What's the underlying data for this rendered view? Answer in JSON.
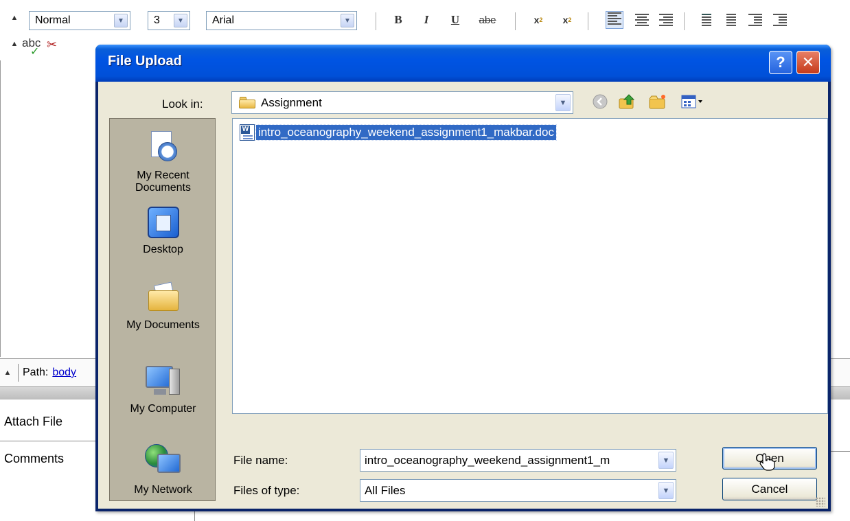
{
  "editor": {
    "toolbar": {
      "style_value": "Normal",
      "size_value": "3",
      "font_value": "Arial",
      "bold": "B",
      "italic": "I",
      "underline": "U",
      "strike": "abe",
      "subscript": "x",
      "superscript": "x",
      "spellcheck": "abc"
    },
    "path_label": "Path:",
    "path_link": "body"
  },
  "form": {
    "attach_label": "Attach File",
    "comments_label": "Comments"
  },
  "dialog": {
    "title": "File Upload",
    "help": "?",
    "close": "✕",
    "look_in_label": "Look in:",
    "look_in_value": "Assignment",
    "places": [
      {
        "label_line1": "My Recent",
        "label_line2": "Documents"
      },
      {
        "label_line1": "Desktop",
        "label_line2": ""
      },
      {
        "label_line1": "My Documents",
        "label_line2": ""
      },
      {
        "label_line1": "My Computer",
        "label_line2": ""
      },
      {
        "label_line1": "My Network",
        "label_line2": ""
      }
    ],
    "files": [
      {
        "name": "intro_oceanography_weekend_assignment1_makbar.doc",
        "selected": true
      }
    ],
    "file_name_label": "File name:",
    "file_name_value": "intro_oceanography_weekend_assignment1_m",
    "file_type_label": "Files of type:",
    "file_type_value": "All Files",
    "open_label": "Open",
    "cancel_label": "Cancel"
  },
  "colors": {
    "titlebar": "#0054e3",
    "dialog_bg": "#ece9d8",
    "selection": "#316ac5",
    "places_bg": "#b9b4a2"
  },
  "icons": {
    "look_in": "folder-icon",
    "back": "back-arrow-icon",
    "up": "up-folder-icon",
    "new_folder": "new-folder-icon",
    "view": "view-menu-icon",
    "file": "word-document-icon"
  }
}
